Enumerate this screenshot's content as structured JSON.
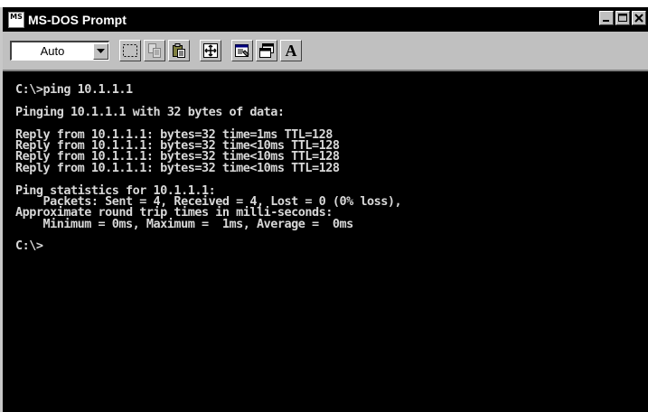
{
  "window": {
    "icon_text": "MS",
    "title": "MS-DOS Prompt",
    "buttons": {
      "minimize": "_",
      "maximize": "□",
      "close": "×"
    }
  },
  "toolbar": {
    "font_size_value": "Auto",
    "font_button_label": "A",
    "icons": [
      "mark-icon",
      "copy-icon",
      "paste-icon",
      "fullscreen-icon",
      "properties-icon",
      "background-icon",
      "font-icon"
    ]
  },
  "console": {
    "lines": [
      "C:\\>ping 10.1.1.1",
      "",
      "Pinging 10.1.1.1 with 32 bytes of data:",
      "",
      "Reply from 10.1.1.1: bytes=32 time=1ms TTL=128",
      "Reply from 10.1.1.1: bytes=32 time<10ms TTL=128",
      "Reply from 10.1.1.1: bytes=32 time<10ms TTL=128",
      "Reply from 10.1.1.1: bytes=32 time<10ms TTL=128",
      "",
      "Ping statistics for 10.1.1.1:",
      "    Packets: Sent = 4, Received = 4, Lost = 0 (0% loss),",
      "Approximate round trip times in milli-seconds:",
      "    Minimum = 0ms, Maximum =  1ms, Average =  0ms",
      "",
      "C:\\>"
    ]
  },
  "colors": {
    "titlebar": "#000000",
    "title_text": "#ffffff",
    "console_bg": "#000000",
    "console_text": "#d8d8d8",
    "chrome": "#c0c0c0"
  }
}
